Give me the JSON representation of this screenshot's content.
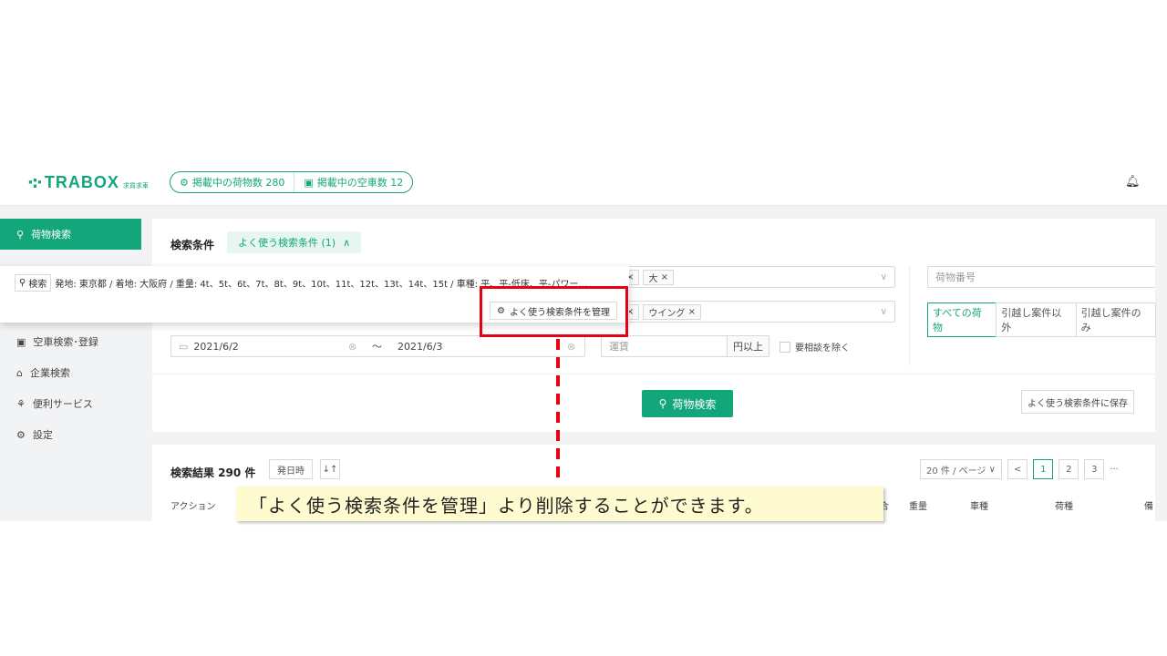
{
  "header": {
    "logo_text": "TRABOX",
    "logo_sub": "求貨求車",
    "cargo_count_label": "掲載中の荷物数 280",
    "vehicle_count_label": "掲載中の空車数 12"
  },
  "sidebar": {
    "items": [
      {
        "label": "荷物検索",
        "icon": "search-icon"
      },
      {
        "label": "空車検索･登録",
        "icon": "truck-icon"
      },
      {
        "label": "企業検索",
        "icon": "building-icon"
      },
      {
        "label": "便利サービス",
        "icon": "service-icon"
      },
      {
        "label": "設定",
        "icon": "gear-icon"
      }
    ]
  },
  "conditions": {
    "title": "検索条件",
    "saved_pill": "よく使う検索条件 (1)",
    "chip_large": "大",
    "chip_wing": "ウイング",
    "cargo_number_placeholder": "荷物番号",
    "segment": [
      "すべての荷物",
      "引越し案件以外",
      "引越し案件のみ"
    ],
    "date_from": "2021/6/2",
    "date_sep": "～",
    "date_to": "2021/6/3",
    "fare_placeholder": "運賃",
    "fare_suffix": "円以上",
    "exclude_consult": "要相談を除く",
    "search_button": "荷物検索",
    "save_button": "よく使う検索条件に保存"
  },
  "dropdown": {
    "search_tag": "検索",
    "summary": "発地: 東京都 / 着地: 大阪府 / 重量: 4t、5t、6t、7t、8t、9t、10t、11t、12t、13t、14t、15t / 車種: 平、平-低床、平-パワー…",
    "manage_button": "よく使う検索条件を管理"
  },
  "results": {
    "title": "検索結果 290 件",
    "sort_label": "発日時",
    "page_size": "20 件 / ページ",
    "pages": [
      "1",
      "2",
      "3"
    ],
    "ellipsis": "···",
    "columns": [
      "アクション",
      "合",
      "重量",
      "車種",
      "荷種",
      "備"
    ]
  },
  "annotation": {
    "callout_text": "「よく使う検索条件を管理」より削除することができます。"
  },
  "colors": {
    "brand": "#13a67a",
    "highlight": "#e50012",
    "callout_bg": "#fffbd0"
  }
}
